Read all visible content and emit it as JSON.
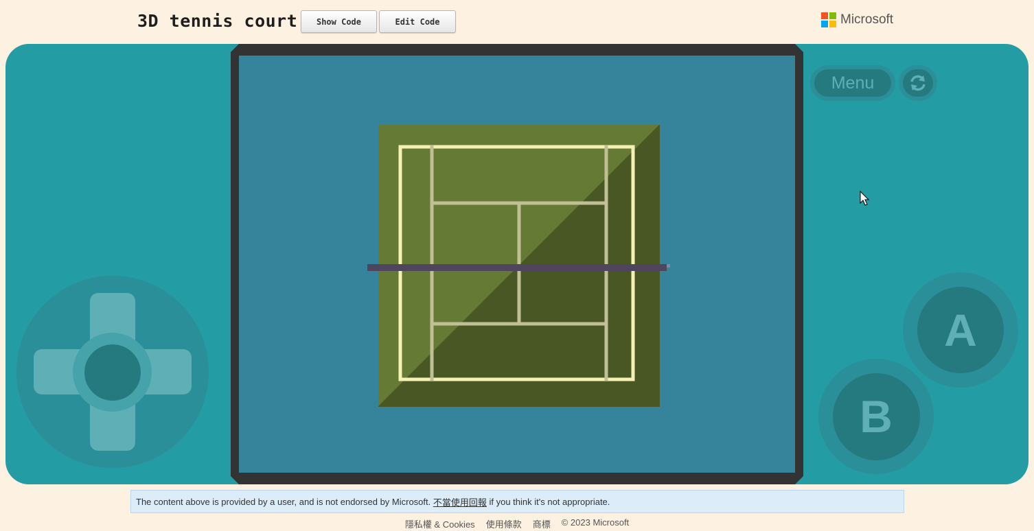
{
  "header": {
    "title": "3D tennis court",
    "show_code_label": "Show Code",
    "edit_code_label": "Edit Code",
    "brand": "Microsoft",
    "brand_colors": [
      "#f35325",
      "#81bc06",
      "#05a6f0",
      "#ffba08"
    ]
  },
  "console": {
    "menu_label": "Menu",
    "refresh_icon": "refresh-icon",
    "a_label": "A",
    "b_label": "B",
    "body_color": "#239ca3",
    "button_color": "#257a80",
    "accent_color": "#5fb0b6"
  },
  "game": {
    "background_color": "#36849c",
    "court_light_color": "#657a35",
    "court_dark_color": "#485724",
    "outer_line_color": "#f5f0b4",
    "inner_line_color": "#c2bf96",
    "net_color": "#50455e"
  },
  "notice": {
    "text_before": "The content above is provided by a user, and is not endorsed by Microsoft. ",
    "link_text": "不當使用回報",
    "text_after": " if you think it's not appropriate."
  },
  "footer": {
    "links": [
      "隱私權 & Cookies",
      "使用條款",
      "商標",
      "© 2023 Microsoft"
    ]
  }
}
